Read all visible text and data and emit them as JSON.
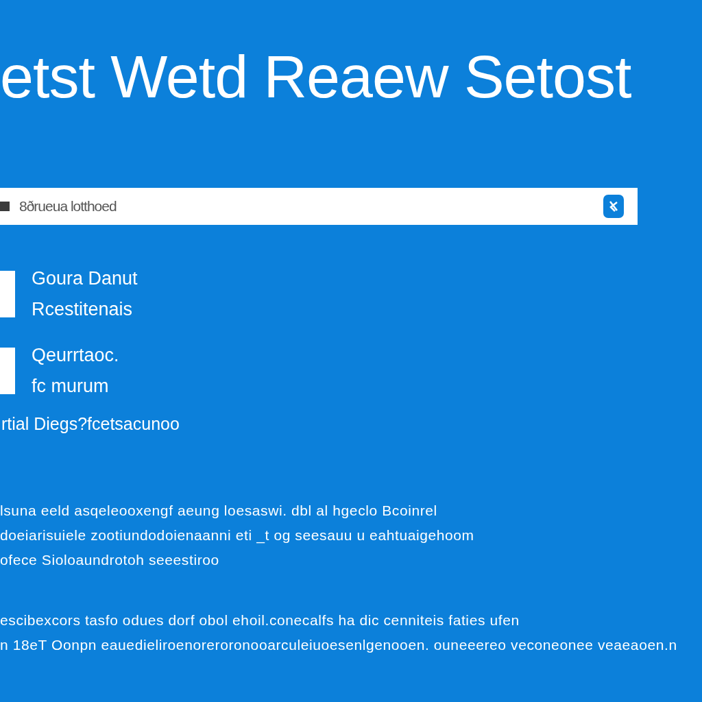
{
  "title": "etst Wetd Reaew Setost",
  "search": {
    "value": "8ðrueua lotthoed"
  },
  "options": [
    {
      "lines": [
        "Goura Danut",
        "Rcestitenais"
      ],
      "checked": false
    },
    {
      "lines": [
        "Qeurrtaoc.",
        "fc murum"
      ],
      "checked": false
    }
  ],
  "note": "rtial Diegs?fcetsacunoo",
  "paragraphs": [
    "lsuna eeld asqeleooxengf aeung loesaswi. dbl al hgeclo Bcoinrel\ndoeiarisuiele zootiundodoienaanni eti _t og seesauu u eahtuaigehoom\nofece Sioloaundrotoh seeestiroo",
    "escibexcors tasfo odues dorf obol ehoil.conecalfs ha dic cenniteis faties ufen\nn 18eT Oonpn eauedieliroenoreroronooarculeiuoesenlgenooen. ouneeereo veconeonee veaeaoen.n"
  ]
}
